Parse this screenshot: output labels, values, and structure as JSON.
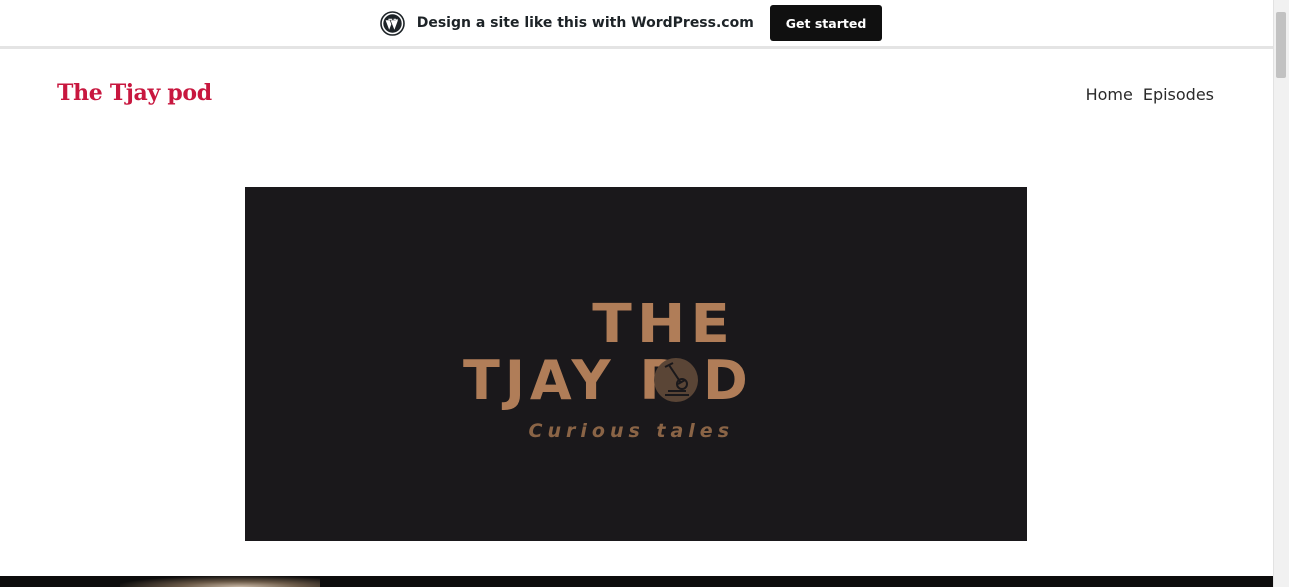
{
  "promo": {
    "text": "Design a site like this with WordPress.com",
    "button_label": "Get started",
    "logo_icon": "wordpress-logo-icon"
  },
  "site": {
    "title": "The Tjay pod",
    "title_color": "#c8173f"
  },
  "nav": {
    "items": [
      {
        "label": "Home"
      },
      {
        "label": "Episodes"
      }
    ]
  },
  "hero": {
    "line1": "THE",
    "line2_left": "TJAY P",
    "line2_right": "D",
    "tagline": "Curious tales",
    "icon": "microscope-icon",
    "background": "#1a181b",
    "accent": "#b07d58"
  }
}
